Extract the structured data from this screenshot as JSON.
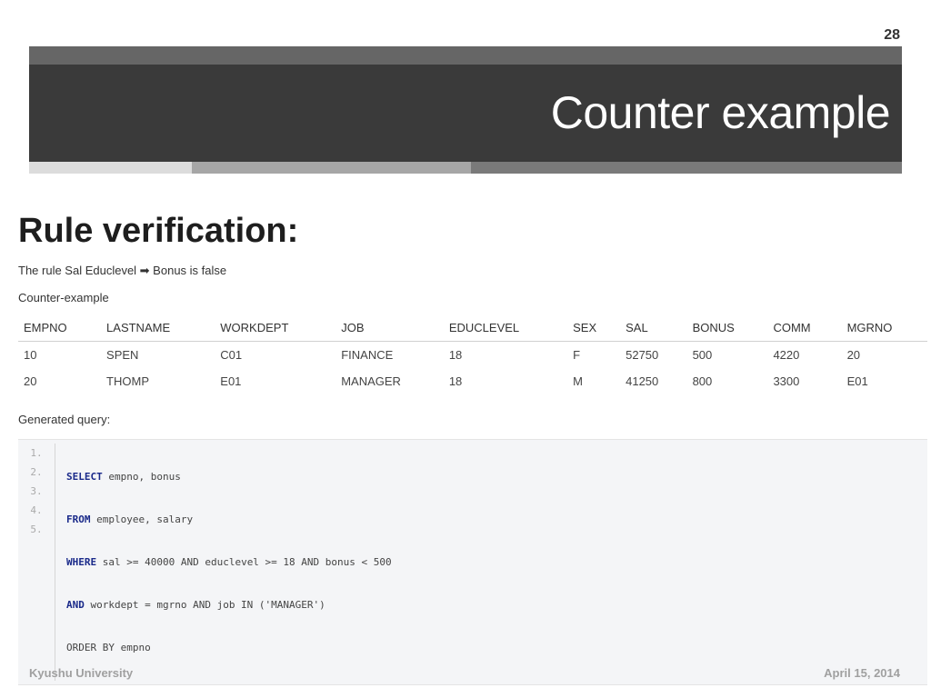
{
  "slide": {
    "page_number": "28",
    "title": "Counter example"
  },
  "content": {
    "heading": "Rule verification:",
    "rule_text": "The rule Sal Educlevel ➡ Bonus is false",
    "counter_label": "Counter-example",
    "table": {
      "headers": [
        "EMPNO",
        "LASTNAME",
        "WORKDEPT",
        "JOB",
        "EDUCLEVEL",
        "SEX",
        "SAL",
        "BONUS",
        "COMM",
        "MGRNO"
      ],
      "rows": [
        [
          "10",
          "SPEN",
          "C01",
          "FINANCE",
          "18",
          "F",
          "52750",
          "500",
          "4220",
          "20"
        ],
        [
          "20",
          "THOMP",
          "E01",
          "MANAGER",
          "18",
          "M",
          "41250",
          "800",
          "3300",
          "E01"
        ]
      ]
    },
    "generated_label": "Generated query:",
    "code": {
      "line_numbers": [
        "1.",
        "2.",
        "3.",
        "4.",
        "5."
      ],
      "lines": [
        {
          "kw": "SELECT",
          "rest": " empno, bonus"
        },
        {
          "kw": "FROM",
          "rest": " employee, salary"
        },
        {
          "kw": "WHERE",
          "rest": " sal >= 40000 AND educlevel >= 18 AND bonus < 500"
        },
        {
          "kw": "AND",
          "rest": " workdept = mgrno AND job IN ('MANAGER')"
        },
        {
          "kw": "",
          "rest": "ORDER BY empno"
        }
      ]
    }
  },
  "footer": {
    "left": "Kyushu University",
    "right": "April 15, 2014"
  }
}
